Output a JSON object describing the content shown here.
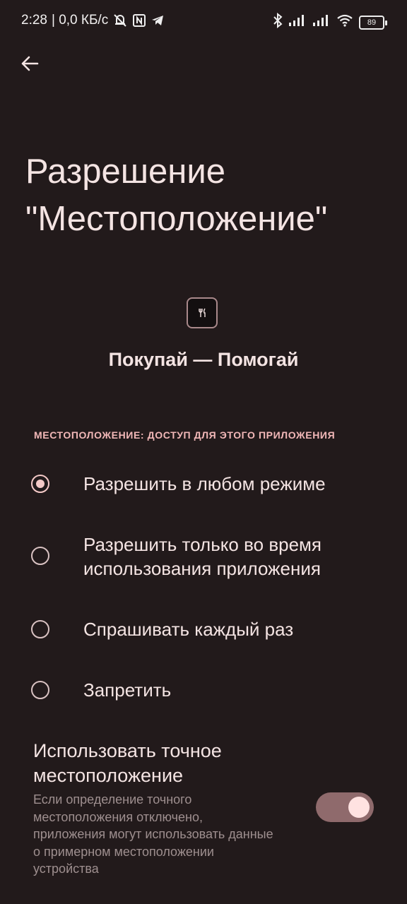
{
  "status_bar": {
    "time": "2:28",
    "network_speed": "| 0,0 КБ/с",
    "battery_level": "89",
    "icons": [
      "muted-bell-icon",
      "nfc-icon",
      "telegram-icon",
      "bluetooth-icon",
      "signal-icon",
      "signal-icon",
      "wifi-icon",
      "battery-icon"
    ]
  },
  "header": {
    "back_icon": "back-arrow-icon",
    "title": "Разрешение \"Местоположение\""
  },
  "app": {
    "icon": "fork-knife-icon",
    "name": "Покупай — Помогай"
  },
  "location_access": {
    "section_title": "МЕСТОПОЛОЖЕНИЕ: ДОСТУП ДЛЯ ЭТОГО ПРИЛОЖЕНИЯ",
    "selected_option": "Разрешить в любом режиме",
    "options": [
      {
        "label": "Разрешить в любом режиме",
        "checked": true
      },
      {
        "label": "Разрешить только во время использования приложения",
        "checked": false
      },
      {
        "label": "Спрашивать каждый раз",
        "checked": false
      },
      {
        "label": "Запретить",
        "checked": false
      }
    ]
  },
  "precise_location": {
    "title": "Использовать точное местоположение",
    "description": "Если определение точного местоположения отключено, приложения могут использовать данные о примерном местоположении устройства",
    "enabled": true
  },
  "colors": {
    "background": "#221a1b",
    "accent": "#f4c9c7",
    "section_header": "#f2b8b8",
    "toggle_track": "#8f6a6c",
    "secondary_text": "#9e8f8f"
  }
}
